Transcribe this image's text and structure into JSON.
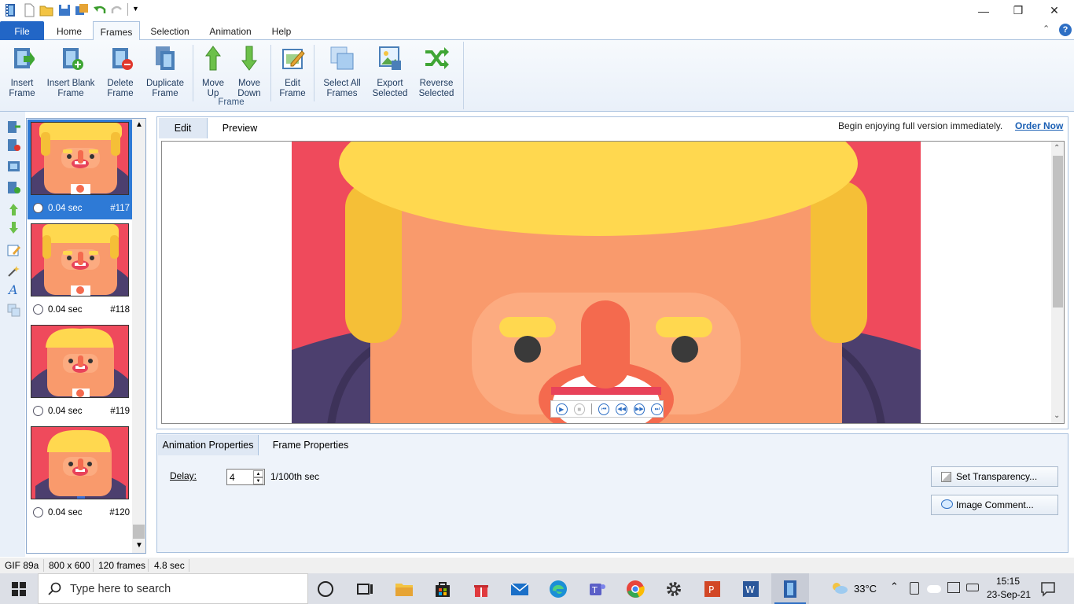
{
  "window": {
    "title_controls": {
      "minimize": "—",
      "restore": "❐",
      "close": "✕"
    }
  },
  "ribbon_tabs": [
    {
      "label": "File"
    },
    {
      "label": "Home"
    },
    {
      "label": "Frames"
    },
    {
      "label": "Selection"
    },
    {
      "label": "Animation"
    },
    {
      "label": "Help"
    }
  ],
  "ribbon": {
    "group_label": "Frame",
    "buttons": [
      {
        "line1": "Insert",
        "line2": "Frame"
      },
      {
        "line1": "Insert Blank",
        "line2": "Frame"
      },
      {
        "line1": "Delete",
        "line2": "Frame"
      },
      {
        "line1": "Duplicate",
        "line2": "Frame"
      },
      {
        "line1": "Move",
        "line2": "Up"
      },
      {
        "line1": "Move",
        "line2": "Down"
      },
      {
        "line1": "Edit",
        "line2": "Frame"
      },
      {
        "line1": "Select All",
        "line2": "Frames"
      },
      {
        "line1": "Export",
        "line2": "Selected"
      },
      {
        "line1": "Reverse",
        "line2": "Selected"
      }
    ]
  },
  "frames": [
    {
      "time": "0.04 sec",
      "num": "#117",
      "selected": true
    },
    {
      "time": "0.04 sec",
      "num": "#118",
      "selected": false
    },
    {
      "time": "0.04 sec",
      "num": "#119",
      "selected": false
    },
    {
      "time": "0.04 sec",
      "num": "#120",
      "selected": false
    }
  ],
  "view_tabs": {
    "edit": "Edit",
    "preview": "Preview"
  },
  "promo": {
    "text": "Begin enjoying full version immediately.",
    "link": "Order Now"
  },
  "prop_tabs": {
    "animation": "Animation Properties",
    "frame": "Frame Properties"
  },
  "frame_props": {
    "delay_label": "Delay:",
    "delay_value": "4",
    "delay_unit": "1/100th sec",
    "transparency_btn": "Set Transparency...",
    "comment_btn": "Image Comment..."
  },
  "status": {
    "format": "GIF 89a",
    "size": "800 x 600",
    "frames": "120 frames",
    "duration": "4.8 sec"
  },
  "taskbar": {
    "search_placeholder": "Type here to search",
    "temperature": "33°C",
    "time": "15:15",
    "date": "23-Sep-21"
  },
  "colors": {
    "accent": "#2266c6",
    "selection": "#2e7ad6",
    "link": "#1a5fb4",
    "art_bg": "#ef4a5c",
    "hair": "#ffd84f",
    "face": "#f99a6c",
    "suit": "#4c3f6e"
  }
}
